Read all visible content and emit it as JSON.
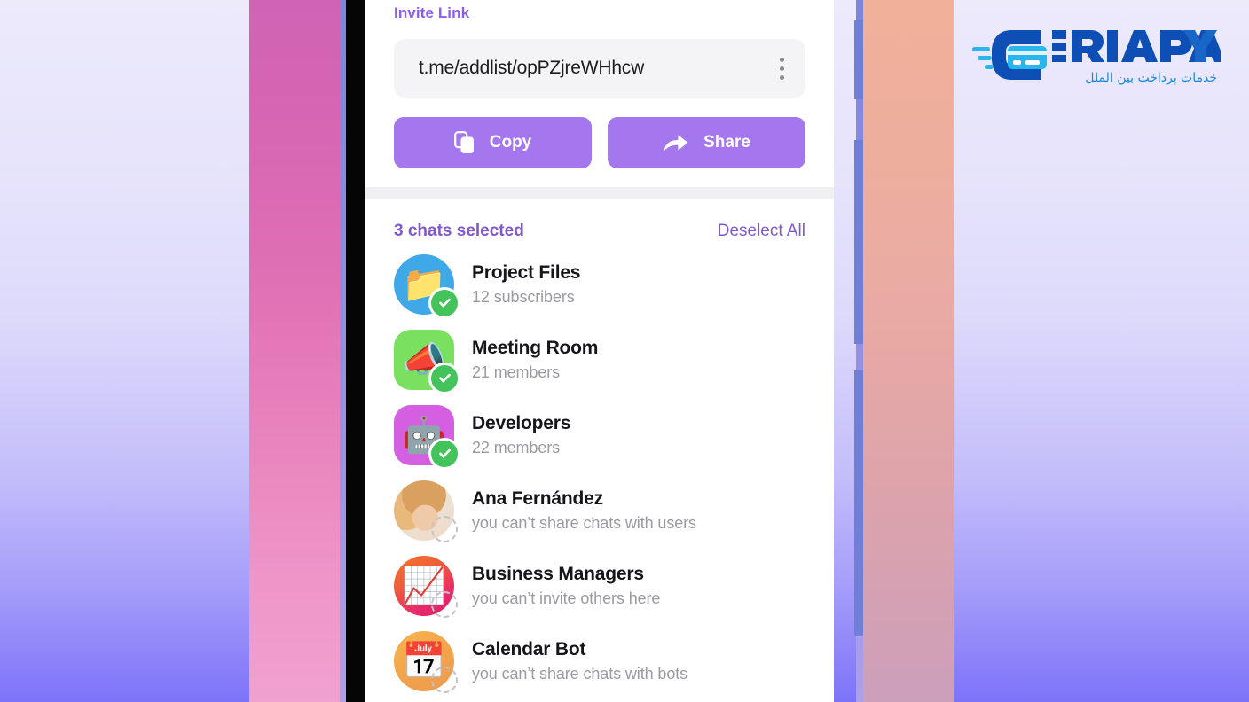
{
  "invite": {
    "title": "Invite Link",
    "link": "t.me/addlist/opPZjreWHhcw",
    "menu_icon": "more-vertical-icon",
    "copy_label": "Copy",
    "copy_icon": "copy-icon",
    "share_label": "Share",
    "share_icon": "share-arrow-icon"
  },
  "selection": {
    "count_label": "3 chats selected",
    "deselect_label": "Deselect All"
  },
  "chats": [
    {
      "title": "Project Files",
      "subtitle": "12 subscribers",
      "emoji": "📁",
      "avatar_shape": "circle",
      "avatar_color": "#3fa9e8",
      "selected": true,
      "state_icon": "check-badge-icon"
    },
    {
      "title": "Meeting Room",
      "subtitle": "21 members",
      "emoji": "📣",
      "avatar_shape": "squircle",
      "avatar_color": "#7ae05f",
      "selected": true,
      "state_icon": "check-badge-icon"
    },
    {
      "title": "Developers",
      "subtitle": "22 members",
      "emoji": "🤖",
      "avatar_shape": "squircle",
      "avatar_color": "#d45fe0",
      "selected": true,
      "state_icon": "check-badge-icon"
    },
    {
      "title": "Ana Fernández",
      "subtitle": "you can’t share chats with users",
      "emoji": "",
      "avatar_shape": "circle",
      "avatar_color": "photo-ana",
      "selected": false,
      "state_icon": "dashed-circle-icon"
    },
    {
      "title": "Business Managers",
      "subtitle": "you can’t invite others here",
      "emoji": "📈",
      "avatar_shape": "circle",
      "avatar_color": "photo-chart",
      "selected": false,
      "state_icon": "dashed-circle-icon"
    },
    {
      "title": "Calendar Bot",
      "subtitle": "you can’t share chats with bots",
      "emoji": "📅",
      "avatar_shape": "circle",
      "avatar_color": "photo-cal",
      "selected": false,
      "state_icon": "dashed-circle-icon"
    }
  ],
  "logo": {
    "brand": "ARIAPAY",
    "tagline_fa": "خدمات پرداخت بین الملل",
    "mark_icon": "card-swipe-icon"
  },
  "theme": {
    "accent_purple": "#8b5cf6",
    "button_purple": "#a577ee",
    "selected_text": "#8159cf",
    "check_green": "#43c35a",
    "field_bg": "#f4f4f6",
    "logo_blue_dark": "#0d4fb5",
    "logo_blue_light": "#29b6ee"
  }
}
